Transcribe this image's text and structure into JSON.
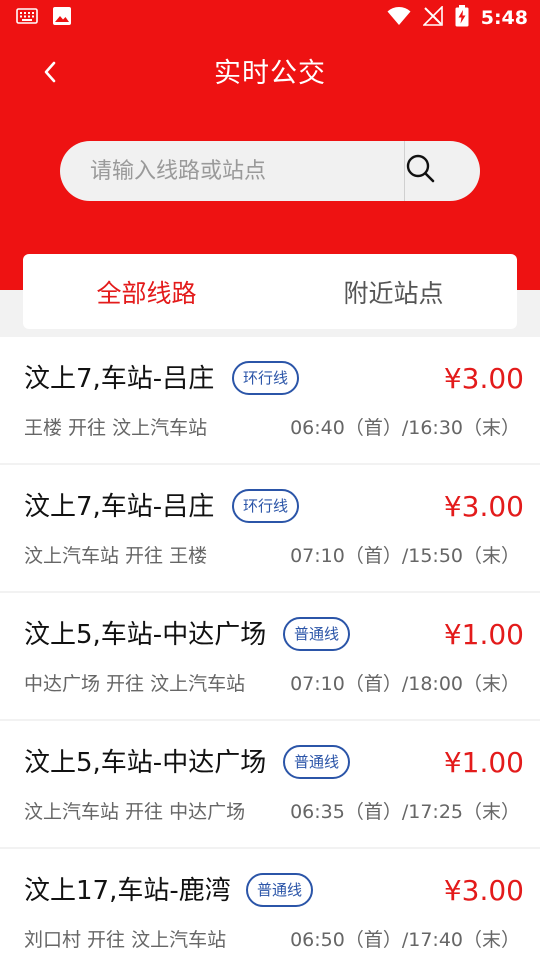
{
  "status": {
    "time": "5:48"
  },
  "header": {
    "title": "实时公交"
  },
  "search": {
    "placeholder": "请输入线路或站点",
    "value": ""
  },
  "tabs": [
    {
      "label": "全部线路",
      "active": true
    },
    {
      "label": "附近站点",
      "active": false
    }
  ],
  "routes": [
    {
      "name": "汶上7,车站-吕庄",
      "type": "环行线",
      "price": "¥3.00",
      "direction": "王楼 开往 汶上汽车站",
      "times": "06:40（首）/16:30（末）"
    },
    {
      "name": "汶上7,车站-吕庄",
      "type": "环行线",
      "price": "¥3.00",
      "direction": "汶上汽车站 开往 王楼",
      "times": "07:10（首）/15:50（末）"
    },
    {
      "name": "汶上5,车站-中达广场",
      "type": "普通线",
      "price": "¥1.00",
      "direction": "中达广场 开往 汶上汽车站",
      "times": "07:10（首）/18:00（末）"
    },
    {
      "name": "汶上5,车站-中达广场",
      "type": "普通线",
      "price": "¥1.00",
      "direction": "汶上汽车站 开往 中达广场",
      "times": "06:35（首）/17:25（末）"
    },
    {
      "name": "汶上17,车站-鹿湾",
      "type": "普通线",
      "price": "¥3.00",
      "direction": "刘口村 开往 汶上汽车站",
      "times": "06:50（首）/17:40（末）"
    }
  ],
  "colors": {
    "brand_red": "#ee1212",
    "price_red": "#e31b1b",
    "badge_blue": "#2b55a8"
  }
}
